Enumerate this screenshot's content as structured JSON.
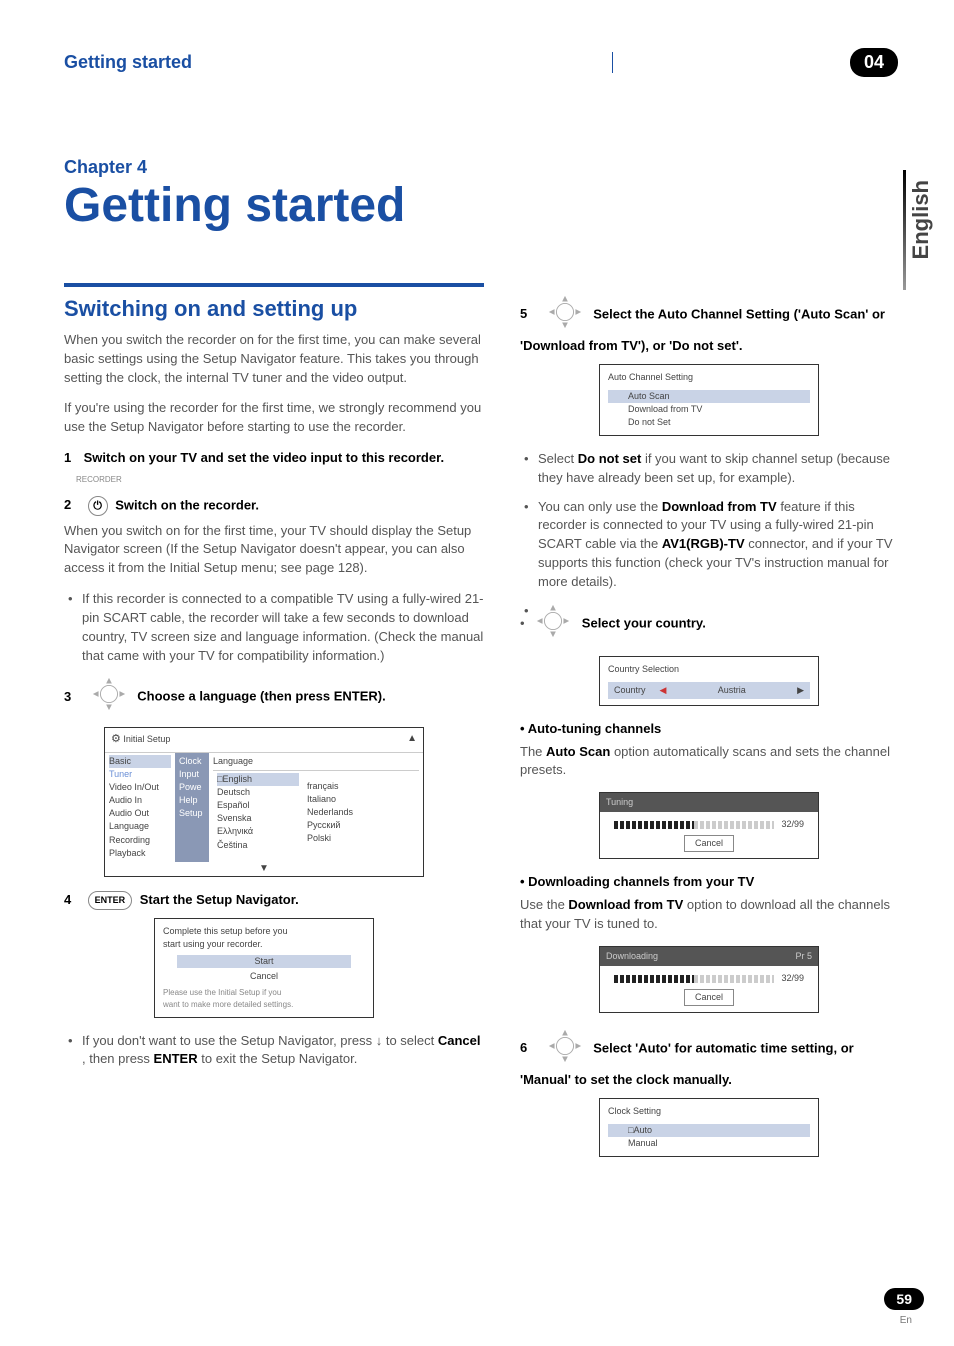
{
  "header": {
    "title": "Getting started",
    "chapter_no": "04"
  },
  "side_tab": "English",
  "chapter": {
    "label": "Chapter 4",
    "title": "Getting started"
  },
  "left": {
    "section_title": "Switching on and setting up",
    "intro1": "When you switch the recorder on for the first time, you can make several basic settings using the Setup Navigator feature. This takes you through setting the clock, the internal TV tuner and the video output.",
    "intro2": "If you're using the recorder for the first time, we strongly recommend you use the Setup Navigator before starting to use the recorder.",
    "step1_num": "1",
    "step1": "Switch on your TV and set the video input to this recorder.",
    "rec_label": "RECORDER",
    "step2_num": "2",
    "step2": "Switch on the recorder.",
    "step2_body": "When you switch on for the first time, your TV should display the Setup Navigator screen (If the Setup Navigator doesn't appear, you can also access it from the Initial Setup menu; see page 128).",
    "step2_bullet": "If this recorder is connected to a compatible TV using a fully-wired 21-pin SCART cable, the recorder will take a few seconds to download country, TV screen size and language information. (Check the manual that came with your TV for compatibility information.)",
    "step3_num": "3",
    "step3": "Choose a language (then press ENTER).",
    "osd1": {
      "title": "Initial Setup",
      "left_items": [
        "Basic",
        "Tuner",
        "Video In/Out",
        "Audio In",
        "Audio Out",
        "Language",
        "Recording",
        "Playback"
      ],
      "mid_items": [
        "Clock",
        "Input",
        "Powe",
        "Help",
        "Setup"
      ],
      "lang_header": "Language",
      "lang_col1": [
        "English",
        "Deutsch",
        "Español",
        "Svenska",
        "Ελληνικά",
        "Čeština"
      ],
      "lang_col2": [
        "français",
        "Italiano",
        "Nederlands",
        "Русский",
        "Polski"
      ],
      "english_marker": "□"
    },
    "step4_num": "4",
    "enter_label": "ENTER",
    "step4": "Start the Setup Navigator.",
    "osd2": {
      "line1": "Complete this setup before you",
      "line2": "start using your recorder.",
      "start": "Start",
      "cancel": "Cancel",
      "foot1": "Please use the Initial Setup if you",
      "foot2": "want to make more detailed settings."
    },
    "step4_bullet_a": "If you don't want to use the Setup Navigator, press ",
    "step4_bullet_b": " to select ",
    "step4_bullet_cancel": "Cancel",
    "step4_bullet_c": ", then press ",
    "step4_bullet_enter": "ENTER",
    "step4_bullet_d": " to exit the Setup Navigator."
  },
  "right": {
    "step5_num": "5",
    "step5": "Select the Auto Channel Setting ('Auto Scan' or 'Download from TV'), or 'Do not set'.",
    "osd3": {
      "title": "Auto Channel Setting",
      "items": [
        "Auto Scan",
        "Download from TV",
        "Do not Set"
      ]
    },
    "bullet1_a": "Select ",
    "bullet1_bold": "Do not set",
    "bullet1_b": " if you want to skip channel setup (because they have already been set up, for example).",
    "bullet2_a": "You can only use the ",
    "bullet2_bold1": "Download from TV",
    "bullet2_b": " feature if this recorder is connected to your TV using a fully-wired 21-pin SCART cable via the ",
    "bullet2_bold2": "AV1(RGB)-TV",
    "bullet2_c": " connector, and if your TV supports this function (check your TV's instruction manual for more details).",
    "select_country": "Select your country.",
    "osd4": {
      "title": "Country Selection",
      "label": "Country",
      "value": "Austria"
    },
    "auto_tuning_head": "Auto-tuning channels",
    "auto_tuning_body_a": "The ",
    "auto_tuning_bold": "Auto Scan",
    "auto_tuning_body_b": " option automatically scans and sets the channel presets.",
    "osd5": {
      "title": "Tuning",
      "progress": "32/99",
      "cancel": "Cancel"
    },
    "download_head": "Downloading channels from your TV",
    "download_body_a": "Use the ",
    "download_bold": "Download from TV",
    "download_body_b": " option to download all the channels that your TV is tuned to.",
    "osd6": {
      "title": "Downloading",
      "pr": "Pr 5",
      "progress": "32/99",
      "cancel": "Cancel"
    },
    "step6_num": "6",
    "step6": "Select 'Auto' for automatic time setting, or 'Manual' to set the clock manually.",
    "osd7": {
      "title": "Clock Setting",
      "auto_marker": "□",
      "auto": "Auto",
      "manual": "Manual"
    }
  },
  "footer": {
    "page": "59",
    "lang": "En"
  },
  "icons": {
    "power": "⏻",
    "down_arrow": "↓",
    "left_tri": "◀",
    "right_tri": "▶",
    "up_tri": "▲",
    "down_tri": "▼"
  }
}
